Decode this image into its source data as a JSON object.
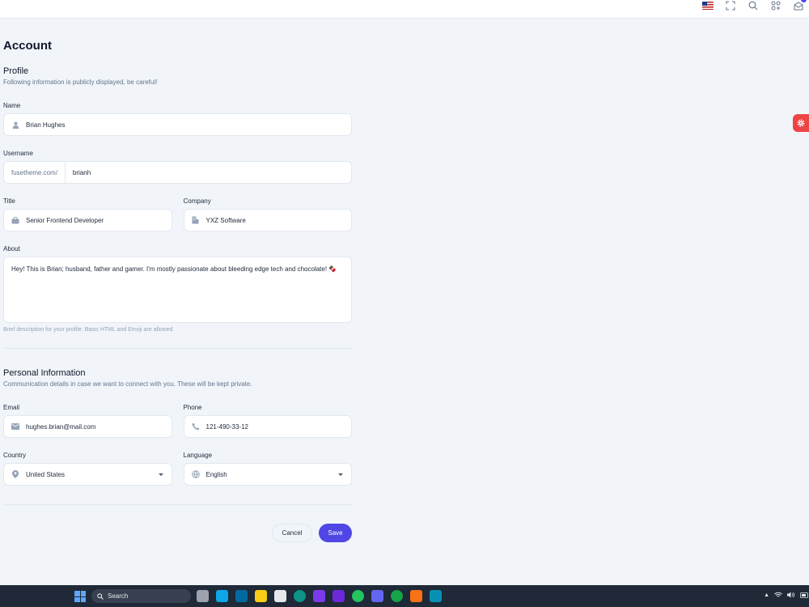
{
  "header": {
    "icons": [
      "flag-us-icon",
      "fullscreen-icon",
      "search-icon",
      "shortcuts-icon",
      "messages-icon"
    ]
  },
  "page": {
    "title": "Account"
  },
  "profile": {
    "title": "Profile",
    "subtitle": "Following information is publicly displayed, be careful!",
    "name_label": "Name",
    "name_value": "Brian Hughes",
    "username_label": "Username",
    "username_prefix": "fusetheme.com/",
    "username_value": "brianh",
    "title_label": "Title",
    "title_value": "Senior Frontend Developer",
    "company_label": "Company",
    "company_value": "YXZ Software",
    "about_label": "About",
    "about_value": "Hey! This is Brian; husband, father and gamer. I'm mostly passionate about bleeding edge tech and chocolate! 🍫",
    "about_hint": "Brief description for your profile. Basic HTML and Emoji are allowed."
  },
  "personal": {
    "title": "Personal Information",
    "subtitle": "Communication details in case we want to connect with you. These will be kept private.",
    "email_label": "Email",
    "email_value": "hughes.brian@mail.com",
    "phone_label": "Phone",
    "phone_value": "121-490-33-12",
    "country_label": "Country",
    "country_value": "United States",
    "language_label": "Language",
    "language_value": "English"
  },
  "actions": {
    "cancel": "Cancel",
    "save": "Save"
  },
  "taskbar": {
    "search_placeholder": "Search"
  },
  "colors": {
    "primary": "#4f46e5",
    "settings_tab": "#ef4444",
    "background": "#f1f5f9"
  }
}
